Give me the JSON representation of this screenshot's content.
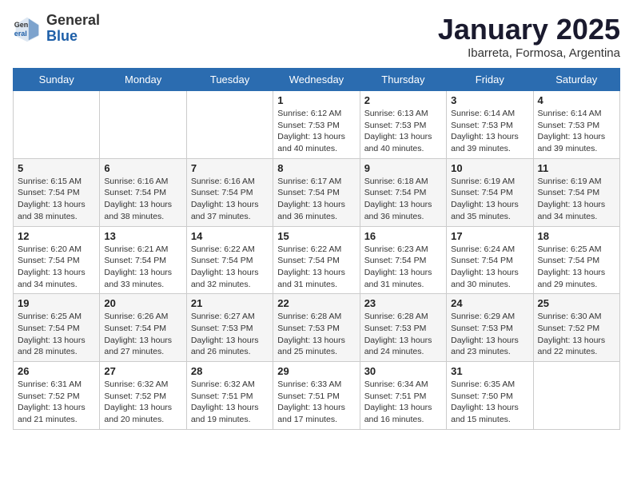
{
  "header": {
    "logo_general": "General",
    "logo_blue": "Blue",
    "title": "January 2025",
    "subtitle": "Ibarreta, Formosa, Argentina"
  },
  "calendar": {
    "days_of_week": [
      "Sunday",
      "Monday",
      "Tuesday",
      "Wednesday",
      "Thursday",
      "Friday",
      "Saturday"
    ],
    "weeks": [
      [
        {
          "day": "",
          "info": ""
        },
        {
          "day": "",
          "info": ""
        },
        {
          "day": "",
          "info": ""
        },
        {
          "day": "1",
          "info": "Sunrise: 6:12 AM\nSunset: 7:53 PM\nDaylight: 13 hours\nand 40 minutes."
        },
        {
          "day": "2",
          "info": "Sunrise: 6:13 AM\nSunset: 7:53 PM\nDaylight: 13 hours\nand 40 minutes."
        },
        {
          "day": "3",
          "info": "Sunrise: 6:14 AM\nSunset: 7:53 PM\nDaylight: 13 hours\nand 39 minutes."
        },
        {
          "day": "4",
          "info": "Sunrise: 6:14 AM\nSunset: 7:53 PM\nDaylight: 13 hours\nand 39 minutes."
        }
      ],
      [
        {
          "day": "5",
          "info": "Sunrise: 6:15 AM\nSunset: 7:54 PM\nDaylight: 13 hours\nand 38 minutes."
        },
        {
          "day": "6",
          "info": "Sunrise: 6:16 AM\nSunset: 7:54 PM\nDaylight: 13 hours\nand 38 minutes."
        },
        {
          "day": "7",
          "info": "Sunrise: 6:16 AM\nSunset: 7:54 PM\nDaylight: 13 hours\nand 37 minutes."
        },
        {
          "day": "8",
          "info": "Sunrise: 6:17 AM\nSunset: 7:54 PM\nDaylight: 13 hours\nand 36 minutes."
        },
        {
          "day": "9",
          "info": "Sunrise: 6:18 AM\nSunset: 7:54 PM\nDaylight: 13 hours\nand 36 minutes."
        },
        {
          "day": "10",
          "info": "Sunrise: 6:19 AM\nSunset: 7:54 PM\nDaylight: 13 hours\nand 35 minutes."
        },
        {
          "day": "11",
          "info": "Sunrise: 6:19 AM\nSunset: 7:54 PM\nDaylight: 13 hours\nand 34 minutes."
        }
      ],
      [
        {
          "day": "12",
          "info": "Sunrise: 6:20 AM\nSunset: 7:54 PM\nDaylight: 13 hours\nand 34 minutes."
        },
        {
          "day": "13",
          "info": "Sunrise: 6:21 AM\nSunset: 7:54 PM\nDaylight: 13 hours\nand 33 minutes."
        },
        {
          "day": "14",
          "info": "Sunrise: 6:22 AM\nSunset: 7:54 PM\nDaylight: 13 hours\nand 32 minutes."
        },
        {
          "day": "15",
          "info": "Sunrise: 6:22 AM\nSunset: 7:54 PM\nDaylight: 13 hours\nand 31 minutes."
        },
        {
          "day": "16",
          "info": "Sunrise: 6:23 AM\nSunset: 7:54 PM\nDaylight: 13 hours\nand 31 minutes."
        },
        {
          "day": "17",
          "info": "Sunrise: 6:24 AM\nSunset: 7:54 PM\nDaylight: 13 hours\nand 30 minutes."
        },
        {
          "day": "18",
          "info": "Sunrise: 6:25 AM\nSunset: 7:54 PM\nDaylight: 13 hours\nand 29 minutes."
        }
      ],
      [
        {
          "day": "19",
          "info": "Sunrise: 6:25 AM\nSunset: 7:54 PM\nDaylight: 13 hours\nand 28 minutes."
        },
        {
          "day": "20",
          "info": "Sunrise: 6:26 AM\nSunset: 7:54 PM\nDaylight: 13 hours\nand 27 minutes."
        },
        {
          "day": "21",
          "info": "Sunrise: 6:27 AM\nSunset: 7:53 PM\nDaylight: 13 hours\nand 26 minutes."
        },
        {
          "day": "22",
          "info": "Sunrise: 6:28 AM\nSunset: 7:53 PM\nDaylight: 13 hours\nand 25 minutes."
        },
        {
          "day": "23",
          "info": "Sunrise: 6:28 AM\nSunset: 7:53 PM\nDaylight: 13 hours\nand 24 minutes."
        },
        {
          "day": "24",
          "info": "Sunrise: 6:29 AM\nSunset: 7:53 PM\nDaylight: 13 hours\nand 23 minutes."
        },
        {
          "day": "25",
          "info": "Sunrise: 6:30 AM\nSunset: 7:52 PM\nDaylight: 13 hours\nand 22 minutes."
        }
      ],
      [
        {
          "day": "26",
          "info": "Sunrise: 6:31 AM\nSunset: 7:52 PM\nDaylight: 13 hours\nand 21 minutes."
        },
        {
          "day": "27",
          "info": "Sunrise: 6:32 AM\nSunset: 7:52 PM\nDaylight: 13 hours\nand 20 minutes."
        },
        {
          "day": "28",
          "info": "Sunrise: 6:32 AM\nSunset: 7:51 PM\nDaylight: 13 hours\nand 19 minutes."
        },
        {
          "day": "29",
          "info": "Sunrise: 6:33 AM\nSunset: 7:51 PM\nDaylight: 13 hours\nand 17 minutes."
        },
        {
          "day": "30",
          "info": "Sunrise: 6:34 AM\nSunset: 7:51 PM\nDaylight: 13 hours\nand 16 minutes."
        },
        {
          "day": "31",
          "info": "Sunrise: 6:35 AM\nSunset: 7:50 PM\nDaylight: 13 hours\nand 15 minutes."
        },
        {
          "day": "",
          "info": ""
        }
      ]
    ]
  }
}
